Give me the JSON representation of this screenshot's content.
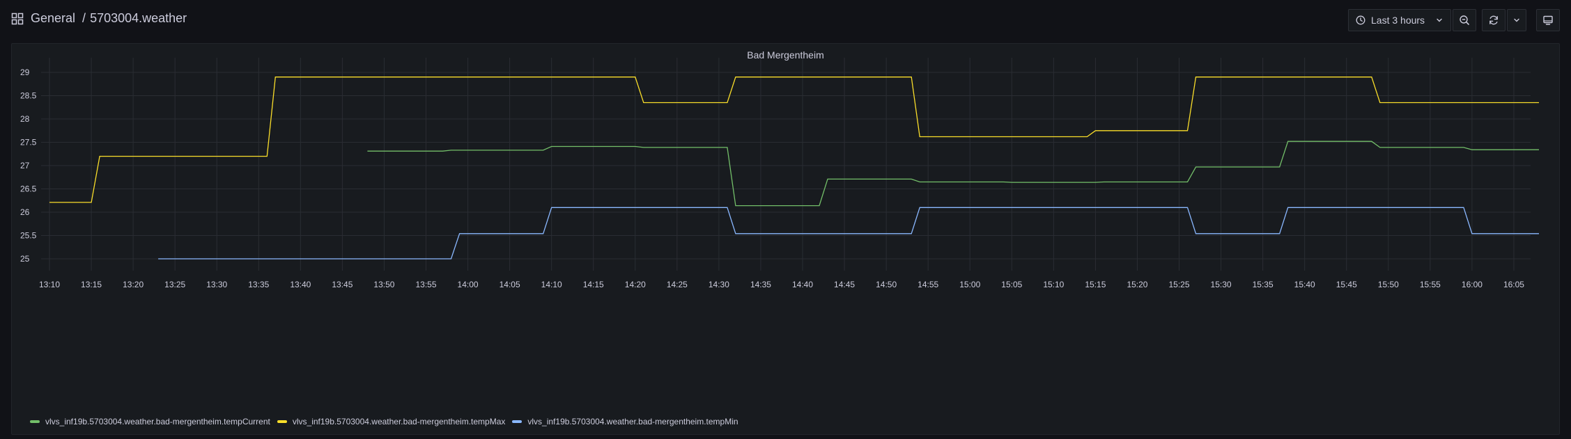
{
  "breadcrumb": {
    "folder": "General",
    "separator": "/",
    "dashboard": "5703004.weather"
  },
  "toolbar": {
    "time_range": "Last 3 hours",
    "icons": [
      "clock-icon",
      "chevron-down-icon",
      "zoom-out-icon",
      "refresh-icon",
      "chevron-down-icon",
      "tv-mode-icon"
    ]
  },
  "panel": {
    "title": "Bad Mergentheim"
  },
  "colors": {
    "tempCurrent": "#73bf69",
    "tempMax": "#fade2a",
    "tempMin": "#8ab8ff",
    "grid": "#2a2d33",
    "text": "#ccccdc"
  },
  "chart_data": {
    "type": "line",
    "title": "Bad Mergentheim",
    "xlabel": "",
    "ylabel": "",
    "xlim": [
      "13:10",
      "16:08"
    ],
    "ylim": [
      24.8,
      29.3
    ],
    "y_ticks": [
      "25",
      "25.5",
      "26",
      "26.5",
      "27",
      "27.5",
      "28",
      "28.5",
      "29"
    ],
    "x_ticks": [
      "13:10",
      "13:15",
      "13:20",
      "13:25",
      "13:30",
      "13:35",
      "13:40",
      "13:45",
      "13:50",
      "13:55",
      "14:00",
      "14:05",
      "14:10",
      "14:15",
      "14:20",
      "14:25",
      "14:30",
      "14:35",
      "14:40",
      "14:45",
      "14:50",
      "14:55",
      "15:00",
      "15:05",
      "15:10",
      "15:15",
      "15:20",
      "15:25",
      "15:30",
      "15:35",
      "15:40",
      "15:45",
      "15:50",
      "15:55",
      "16:00",
      "16:05"
    ],
    "grid": true,
    "legend": "bottom-left",
    "series": [
      {
        "name": "vlvs_inf19b.5703004.weather.bad-mergentheim.tempCurrent",
        "color": "#73bf69",
        "points": [
          [
            "13:48",
            27.31
          ],
          [
            "13:57",
            27.31
          ],
          [
            "13:58",
            27.33
          ],
          [
            "14:09",
            27.33
          ],
          [
            "14:10",
            27.41
          ],
          [
            "14:20",
            27.41
          ],
          [
            "14:21",
            27.39
          ],
          [
            "14:31",
            27.39
          ],
          [
            "14:32",
            26.14
          ],
          [
            "14:42",
            26.14
          ],
          [
            "14:43",
            26.71
          ],
          [
            "14:53",
            26.71
          ],
          [
            "14:54",
            26.65
          ],
          [
            "15:04",
            26.65
          ],
          [
            "15:05",
            26.64
          ],
          [
            "15:15",
            26.64
          ],
          [
            "15:16",
            26.65
          ],
          [
            "15:26",
            26.65
          ],
          [
            "15:27",
            26.97
          ],
          [
            "15:37",
            26.97
          ],
          [
            "15:38",
            27.52
          ],
          [
            "15:48",
            27.52
          ],
          [
            "15:49",
            27.39
          ],
          [
            "15:59",
            27.39
          ],
          [
            "16:00",
            27.34
          ],
          [
            "16:08",
            27.34
          ]
        ]
      },
      {
        "name": "vlvs_inf19b.5703004.weather.bad-mergentheim.tempMax",
        "color": "#fade2a",
        "points": [
          [
            "13:10",
            26.21
          ],
          [
            "13:15",
            26.21
          ],
          [
            "13:16",
            27.2
          ],
          [
            "13:36",
            27.2
          ],
          [
            "13:37",
            28.9
          ],
          [
            "14:20",
            28.9
          ],
          [
            "14:21",
            28.35
          ],
          [
            "14:31",
            28.35
          ],
          [
            "14:32",
            28.9
          ],
          [
            "14:53",
            28.9
          ],
          [
            "14:54",
            27.62
          ],
          [
            "15:14",
            27.62
          ],
          [
            "15:15",
            27.75
          ],
          [
            "15:26",
            27.75
          ],
          [
            "15:27",
            28.9
          ],
          [
            "15:48",
            28.9
          ],
          [
            "15:49",
            28.35
          ],
          [
            "16:08",
            28.35
          ]
        ]
      },
      {
        "name": "vlvs_inf19b.5703004.weather.bad-mergentheim.tempMin",
        "color": "#8ab8ff",
        "points": [
          [
            "13:23",
            25.0
          ],
          [
            "13:58",
            25.0
          ],
          [
            "13:59",
            25.54
          ],
          [
            "14:09",
            25.54
          ],
          [
            "14:10",
            26.1
          ],
          [
            "14:31",
            26.1
          ],
          [
            "14:32",
            25.54
          ],
          [
            "14:53",
            25.54
          ],
          [
            "14:54",
            26.1
          ],
          [
            "15:26",
            26.1
          ],
          [
            "15:27",
            25.54
          ],
          [
            "15:37",
            25.54
          ],
          [
            "15:38",
            26.1
          ],
          [
            "15:59",
            26.1
          ],
          [
            "16:00",
            25.54
          ],
          [
            "16:08",
            25.54
          ]
        ]
      }
    ]
  }
}
